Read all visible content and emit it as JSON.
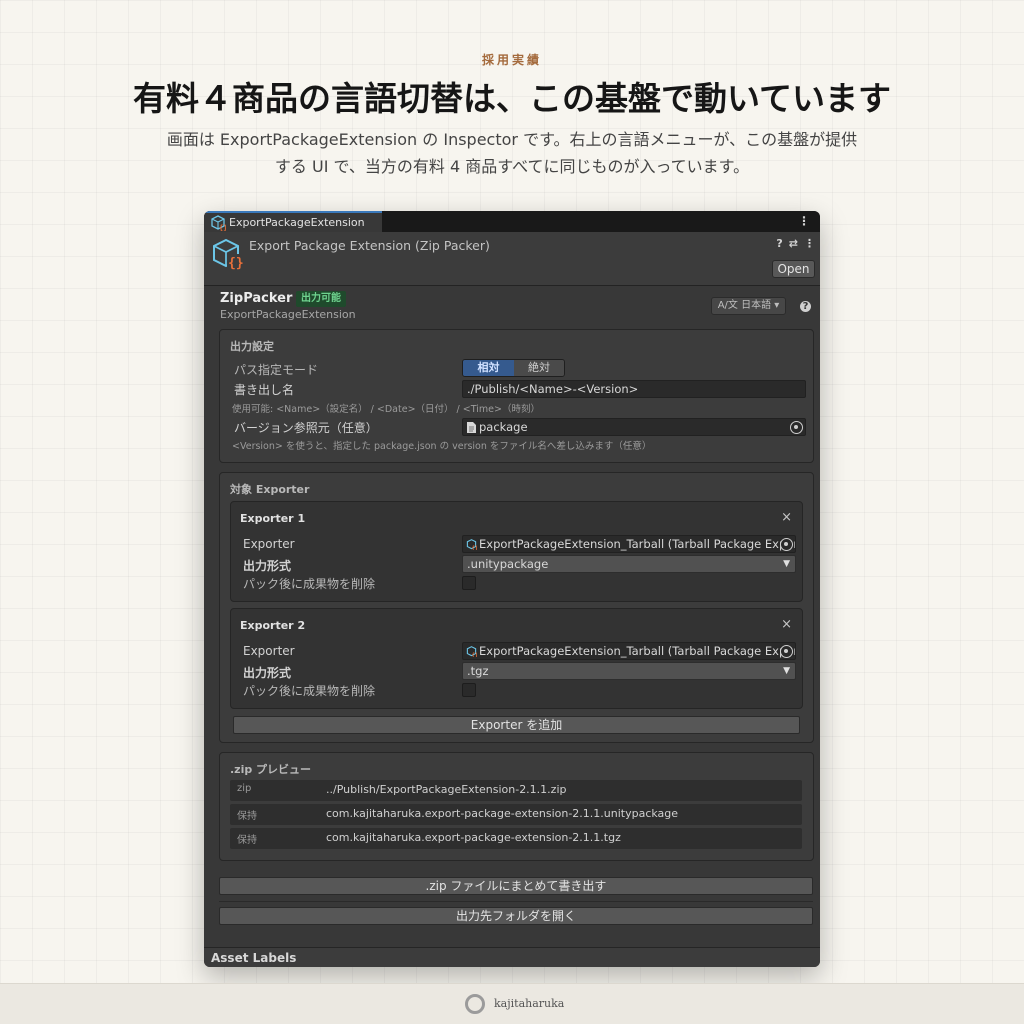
{
  "page": {
    "eyebrow": "採用実績",
    "headline": "有料４商品の言語切替は、この基盤で動いています",
    "lead": "画面は ExportPackageExtension の Inspector です。右上の言語メニューが、この基盤が提供する UI で、当方の有料 4 商品すべてに同じものが入っています。"
  },
  "window": {
    "tab_label": "ExportPackageExtension",
    "tab_menu": "⋮",
    "header_title": "Export Package Extension (Zip Packer)",
    "header_tools": [
      "?",
      "⇄",
      "⋮"
    ],
    "open_button": "Open",
    "component": {
      "title": "ZipPacker",
      "status": "出力可能",
      "subtitle": "ExportPackageExtension",
      "language_select": "A/文 日本語 ▾",
      "help": "?"
    },
    "output_settings": {
      "title": "出力設定",
      "path_mode_label": "パス指定モード",
      "path_mode_options": [
        "相対",
        "絶対"
      ],
      "filename_label": "書き出し名",
      "filename_value": "./Publish/<Name>-<Version>",
      "filename_note": "使用可能: <Name>（設定名） / <Date>（日付） / <Time>（時刻）",
      "version_label": "バージョン参照元（任意）",
      "version_value": "package",
      "version_note": "<Version> を使うと、指定した package.json の version をファイル名へ差し込みます（任意）"
    },
    "exporters": {
      "title": "対象 Exporter",
      "items": [
        {
          "title": "Exporter 1",
          "exporter_label": "Exporter",
          "exporter_value": "ExportPackageExtension_Tarball (Tarball Package Exporter)",
          "format_label": "出力形式",
          "format_value": ".unitypackage",
          "delete_label": "パック後に成果物を削除",
          "delete_checked": false
        },
        {
          "title": "Exporter 2",
          "exporter_label": "Exporter",
          "exporter_value": "ExportPackageExtension_Tarball (Tarball Package Exporter)",
          "format_label": "出力形式",
          "format_value": ".tgz",
          "delete_label": "パック後に成果物を削除",
          "delete_checked": false
        }
      ],
      "add_button": "Exporter を追加",
      "close_icon": "×"
    },
    "preview": {
      "title": ".zip プレビュー",
      "rows": [
        {
          "kind": "zip",
          "value": "../Publish/ExportPackageExtension-2.1.1.zip"
        },
        {
          "kind": "保持",
          "value": "com.kajitaharuka.export-package-extension-2.1.1.unitypackage"
        },
        {
          "kind": "保持",
          "value": "com.kajitaharuka.export-package-extension-2.1.1.tgz"
        }
      ]
    },
    "actions": {
      "export_zip": ".zip ファイルにまとめて書き出す",
      "open_folder": "出力先フォルダを開く"
    },
    "asset_labels": "Asset Labels"
  },
  "footer": {
    "brand": "kajitaharuka"
  },
  "colors": {
    "accent_blue": "#3a79bb",
    "status_green": "#6fd38f",
    "icon_orange": "#e8703a",
    "icon_cyan": "#6cc6e8"
  }
}
